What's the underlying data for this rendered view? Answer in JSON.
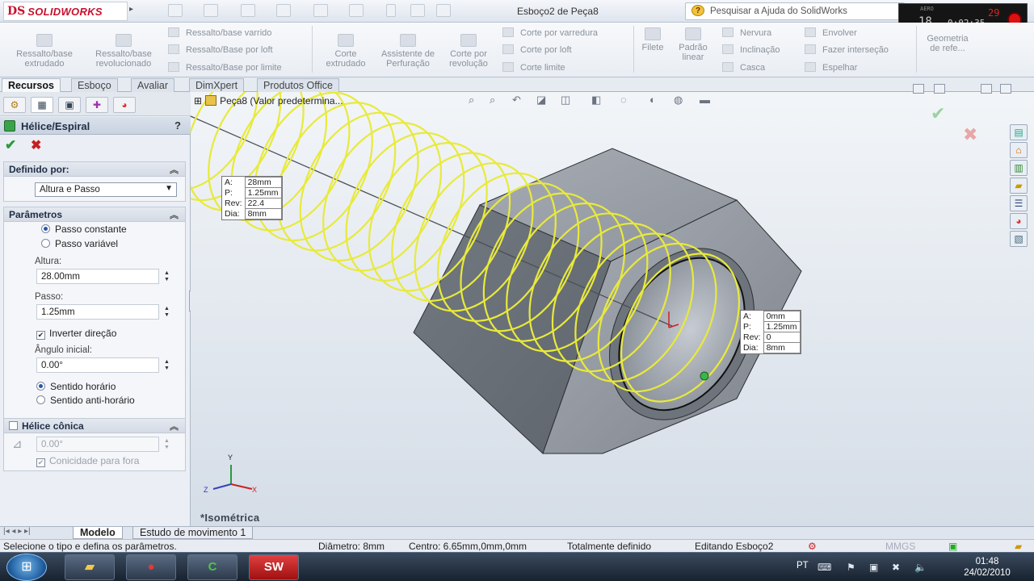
{
  "app": {
    "logo_text": "SOLIDWORKS",
    "document_title": "Esboço2 de Peça8",
    "help_search_placeholder": "Pesquisar a Ajuda do SolidWorks"
  },
  "recorder": {
    "label": "AERO",
    "frames": "29",
    "big": "18",
    "time": "0:02:35"
  },
  "ribbon": {
    "features": [
      {
        "label": "Ressalto/base extrudado"
      },
      {
        "label": "Ressalto/base revolucionado"
      }
    ],
    "boss_small": [
      "Ressalto/base varrido",
      "Ressalto/Base por loft",
      "Ressalto/Base por limite"
    ],
    "cut_buttons": [
      {
        "label": "Corte extrudado"
      },
      {
        "label": "Assistente de Perfuração"
      },
      {
        "label": "Corte por revolução"
      }
    ],
    "cut_small": [
      "Corte por varredura",
      "Corte por loft",
      "Corte limite"
    ],
    "fillet": "Filete",
    "pattern": "Padrão linear",
    "misc_small": [
      "Nervura",
      "Inclinação",
      "Casca"
    ],
    "misc_small2": [
      "Envolver",
      "Fazer interseção",
      "Espelhar"
    ],
    "geometry": "Geometria de refe..."
  },
  "command_tabs": [
    "Recursos",
    "Esboço",
    "Avaliar",
    "DimXpert",
    "Produtos Office"
  ],
  "property_manager": {
    "title": "Hélice/Espiral",
    "help": "?",
    "defined_by": {
      "header": "Definido por:",
      "value": "Altura e Passo"
    },
    "parameters": {
      "header": "Parâmetros",
      "pitch_constant": "Passo constante",
      "pitch_variable": "Passo variável",
      "height_label": "Altura:",
      "height_value": "28.00mm",
      "pitch_label": "Passo:",
      "pitch_value": "1.25mm",
      "reverse_direction": "Inverter direção",
      "start_angle_label": "Ângulo inicial:",
      "start_angle_value": "0.00°",
      "clockwise": "Sentido horário",
      "counterclockwise": "Sentido anti-horário"
    },
    "taper": {
      "header": "Hélice cônica",
      "angle_value": "0.00°",
      "taper_outward": "Conicidade para fora"
    }
  },
  "viewport": {
    "tree_item": "Peça8  (Valor predetermina...",
    "view_label": "*Isométrica",
    "tag_top": {
      "a_label": "A:",
      "a": "28mm",
      "p_label": "P:",
      "p": "1.25mm",
      "rev_label": "Rev:",
      "rev": "22.4",
      "dia_label": "Dia:",
      "dia": "8mm"
    },
    "tag_bottom": {
      "a_label": "A:",
      "a": "0mm",
      "p_label": "P:",
      "p": "1.25mm",
      "rev_label": "Rev:",
      "rev": "0",
      "dia_label": "Dia:",
      "dia": "8mm"
    },
    "triad": {
      "x": "X",
      "y": "Y",
      "z": "Z"
    },
    "helix_color": "#e8ea3a",
    "nut_color": "#8e949c"
  },
  "bottom_tabs": [
    "Modelo",
    "Estudo de movimento 1"
  ],
  "status": {
    "message": "Selecione o tipo e defina os parâmetros.",
    "diameter": "Diâmetro: 8mm",
    "center": "Centro: 6.65mm,0mm,0mm",
    "definition": "Totalmente definido",
    "editing": "Editando Esboço2",
    "units": "MMGS"
  },
  "taskbar": {
    "lang": "PT",
    "time": "01:48",
    "date": "24/02/2010",
    "apps": [
      "windows-explorer",
      "media-player",
      "camtasia",
      "solidworks"
    ],
    "solidworks_label": "SW"
  }
}
